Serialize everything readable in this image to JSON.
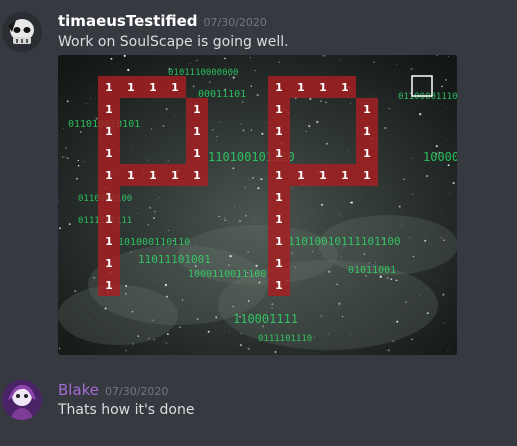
{
  "messages": [
    {
      "username": "timaeusTestified",
      "username_color": "#ffffff",
      "timestamp": "07/30/2020",
      "text": "Work on SoulScape is going well.",
      "avatar_icon": "skull-avatar-icon"
    },
    {
      "username": "Blake",
      "username_color": "#a46bd6",
      "timestamp": "07/30/2020",
      "text": "Thats how it's done",
      "avatar_icon": "purple-character-avatar-icon"
    }
  ],
  "image": {
    "digit": "1",
    "binary_strings": [
      "0101110000000",
      "00011101",
      "011010010101",
      "1000000",
      "110100101110",
      "0110000100",
      "0111101111",
      "101000110110",
      "11010010111101100",
      "11011101001",
      "01011001",
      "1000110011100",
      "011000011100",
      "110001111",
      "0111101110"
    ]
  }
}
